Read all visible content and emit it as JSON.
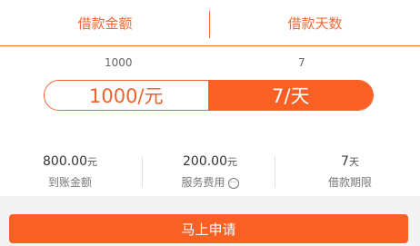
{
  "header": {
    "amount_tab": "借款金额",
    "days_tab": "借款天数"
  },
  "current": {
    "amount": "1000",
    "days": "7"
  },
  "selector": {
    "amount_label": "1000/元",
    "days_label": "7/天"
  },
  "stats": {
    "received": {
      "value": "800.00",
      "unit": "元",
      "label": "到账金额"
    },
    "service": {
      "value": "200.00",
      "unit": "元",
      "label": "服务费用",
      "icon": "more-info-icon"
    },
    "term": {
      "value": "7",
      "unit": "天",
      "label": "借款期限"
    }
  },
  "apply": {
    "label": "马上申请"
  },
  "colors": {
    "accent": "#fa5f24",
    "accent_line": "#f06a35"
  }
}
